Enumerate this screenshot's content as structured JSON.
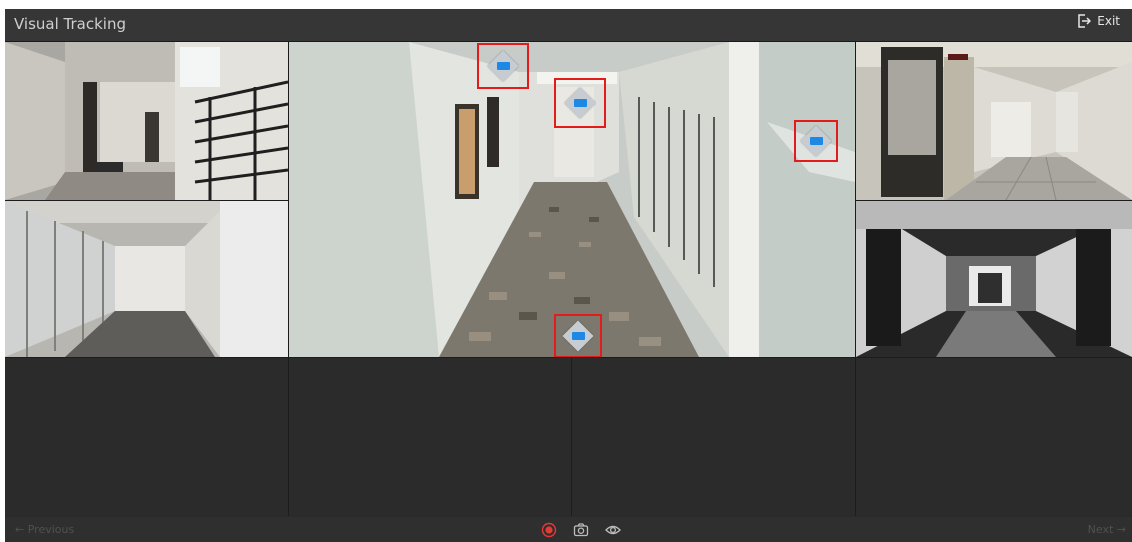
{
  "titlebar": {
    "title": "Visual Tracking",
    "exit_label": "Exit",
    "exit_icon": "exit-icon"
  },
  "grid": {
    "views": [
      {
        "name": "camera-view-stairwell",
        "description": ""
      },
      {
        "name": "camera-view-main-corridor",
        "description": ""
      },
      {
        "name": "camera-view-door-hallway",
        "description": ""
      },
      {
        "name": "camera-view-glass-office-hall",
        "description": ""
      },
      {
        "name": "camera-view-dark-corridor",
        "description": ""
      }
    ],
    "empty_slots": 4,
    "marker_color": "#e31b1b",
    "camera_icon_color": "#1e88e5"
  },
  "bottombar": {
    "previous_label": "Previous",
    "next_label": "Next",
    "record_color": "#e53935",
    "icons": [
      "record-icon",
      "snapshot-icon",
      "view-icon"
    ]
  }
}
